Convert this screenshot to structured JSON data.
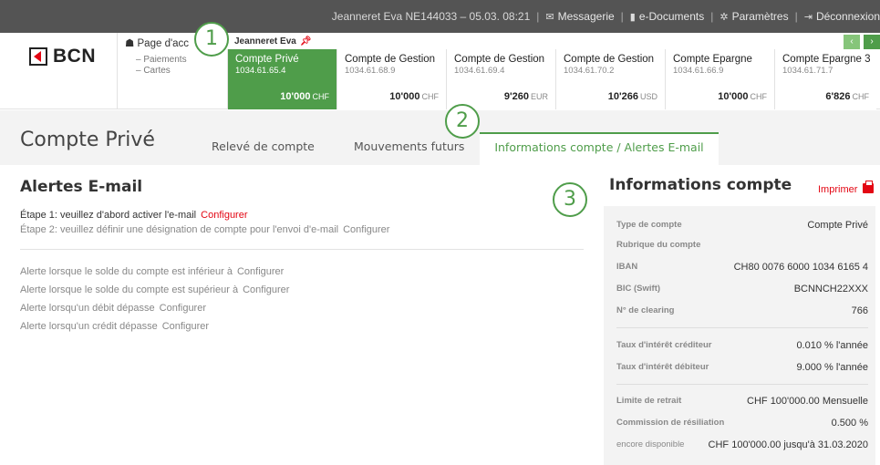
{
  "topbar": {
    "user_info": "Jeanneret Eva   NE144033 – 05.03. 08:21",
    "messagerie": "Messagerie",
    "edocuments": "e-Documents",
    "parametres": "Paramètres",
    "deconnexion": "Déconnexion"
  },
  "logo": {
    "text": "BCN"
  },
  "nav": {
    "home": "Page d'acc",
    "sub1": "– Paiements",
    "sub2": "– Cartes"
  },
  "user": {
    "name": "Jeanneret Eva"
  },
  "accounts": [
    {
      "name": "Compte Privé",
      "iban": "1034.61.65.4",
      "balance": "10'000",
      "currency": "CHF"
    },
    {
      "name": "Compte de Gestion",
      "iban": "1034.61.68.9",
      "balance": "10'000",
      "currency": "CHF"
    },
    {
      "name": "Compte de Gestion",
      "iban": "1034.61.69.4",
      "balance": "9'260",
      "currency": "EUR"
    },
    {
      "name": "Compte de Gestion",
      "iban": "1034.61.70.2",
      "balance": "10'266",
      "currency": "USD"
    },
    {
      "name": "Compte Epargne",
      "iban": "1034.61.66.9",
      "balance": "10'000",
      "currency": "CHF"
    },
    {
      "name": "Compte Epargne 3",
      "iban": "1034.61.71.7",
      "balance": "6'826",
      "currency": "CHF"
    }
  ],
  "page": {
    "title": "Compte Privé",
    "tabs": [
      "Relevé de compte",
      "Mouvements futurs",
      "Informations compte / Alertes E-mail"
    ]
  },
  "callouts": [
    "1",
    "2",
    "3"
  ],
  "alerts": {
    "title": "Alertes E-mail",
    "step1": "Étape 1: veuillez d'abord activer l'e-mail",
    "step2": "Étape 2: veuillez définir une désignation de compte pour l'envoi d'e-mail",
    "configure": "Configurer",
    "lines": [
      "Alerte lorsque le solde du compte est inférieur à",
      "Alerte lorsque le solde du compte est supérieur à",
      "Alerte lorsqu'un débit dépasse",
      "Alerte lorsqu'un crédit dépasse"
    ]
  },
  "info": {
    "title": "Informations compte",
    "print": "Imprimer",
    "rows": [
      {
        "label": "Type de compte",
        "value": "Compte Privé"
      },
      {
        "label": "Rubrique du compte",
        "value": ""
      },
      {
        "label": "IBAN",
        "value": "CH80 0076 6000 1034 6165 4"
      },
      {
        "label": "BIC (Swift)",
        "value": "BCNNCH22XXX"
      },
      {
        "label": "N° de clearing",
        "value": "766"
      },
      {
        "label": "Taux d'intérêt créditeur",
        "value": "0.010 % l'année"
      },
      {
        "label": "Taux d'intérêt débiteur",
        "value": "9.000 % l'année"
      },
      {
        "label": "Limite de retrait",
        "value": "CHF 100'000.00 Mensuelle"
      },
      {
        "label": "Commission de résiliation",
        "value": "0.500 %"
      },
      {
        "label": "encore disponible",
        "value": "CHF 100'000.00 jusqu'à 31.03.2020"
      }
    ]
  }
}
